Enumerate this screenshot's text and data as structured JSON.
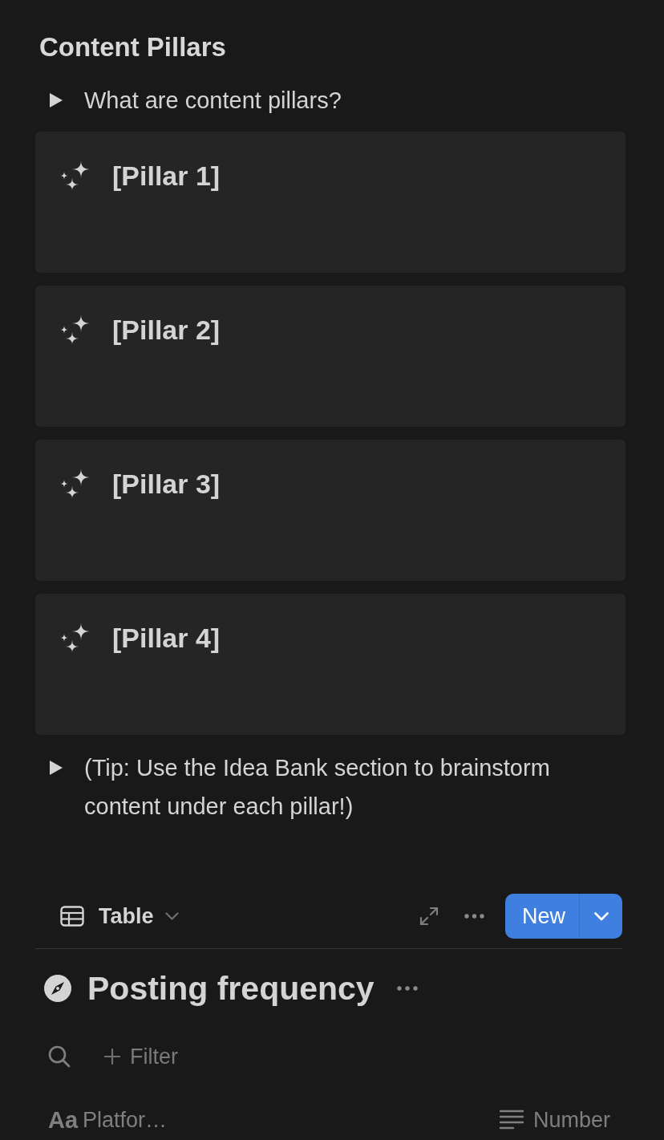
{
  "page_title": "Content Pillars",
  "intro_toggle": {
    "label": "What are content pillars?",
    "expanded": false
  },
  "pillars": [
    {
      "title": "[Pillar 1]"
    },
    {
      "title": "[Pillar 2]"
    },
    {
      "title": "[Pillar 3]"
    },
    {
      "title": "[Pillar 4]"
    }
  ],
  "tip_toggle": {
    "label": "(Tip: Use the Idea Bank section to brainstorm content under each pillar!)",
    "expanded": false
  },
  "database": {
    "view_tab": {
      "label": "Table"
    },
    "new_button": {
      "label": "New"
    },
    "title": "Posting frequency",
    "filter_button": {
      "label": "Filter"
    },
    "columns": [
      {
        "kind": "title",
        "type_icon": "Aa",
        "label": "Platfor…"
      },
      {
        "kind": "number",
        "label": "Number"
      }
    ]
  }
}
